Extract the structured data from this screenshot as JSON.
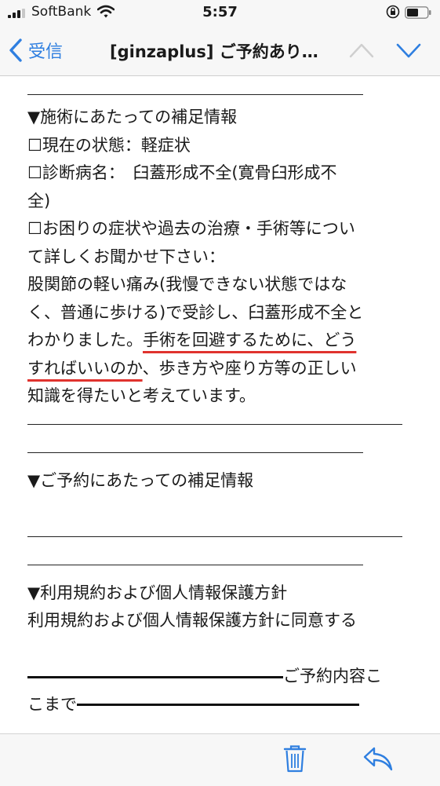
{
  "status_bar": {
    "carrier": "SoftBank",
    "time": "5:57",
    "icons": [
      "signal-icon",
      "wifi-icon",
      "orientation-lock-icon",
      "battery-icon"
    ]
  },
  "nav": {
    "back_label": "受信",
    "title": "[ginzaplus] ご予約あり…",
    "icons": [
      "chevron-left-icon",
      "chevron-up-icon",
      "chevron-down-icon"
    ],
    "accent_color": "#2f7fe0"
  },
  "body": {
    "s1_heading": "▼施術にあたっての補足情報",
    "s1_current_state": "☐現在の状態：軽症状",
    "s1_diagnosis_line1": "☐診断病名：　臼蓋形成不全(寛骨臼形成不",
    "s1_diagnosis_line2": "全)",
    "s1_question_line1": "☐お困りの症状や過去の治療・手術等につい",
    "s1_question_line2": "て詳しくお聞かせ下さい：",
    "s1_answer_line1": "股関節の軽い痛み(我慢できない状態ではな",
    "s1_answer_line2": "く、普通に歩ける)で受診し、臼蓋形成不全と",
    "s1_answer_line3_a": "わかりました。",
    "s1_answer_line3_b": "手術を回避するために、どう",
    "s1_answer_line4_a": "すればいいのか",
    "s1_answer_line4_b": "、歩き方や座り方等の正しい",
    "s1_answer_line5": "知識を得たいと考えています。",
    "s2_heading": "▼ご予約にあたっての補足情報",
    "s3_heading": "▼利用規約および個人情報保護方針",
    "s3_text": "利用規約および個人情報保護方針に同意する",
    "end_text_a": "ご予約内容こ",
    "end_text_b": "こまで",
    "highlight_color": "#e0332e"
  },
  "toolbar": {
    "icons": [
      "trash-icon",
      "reply-icon"
    ]
  }
}
